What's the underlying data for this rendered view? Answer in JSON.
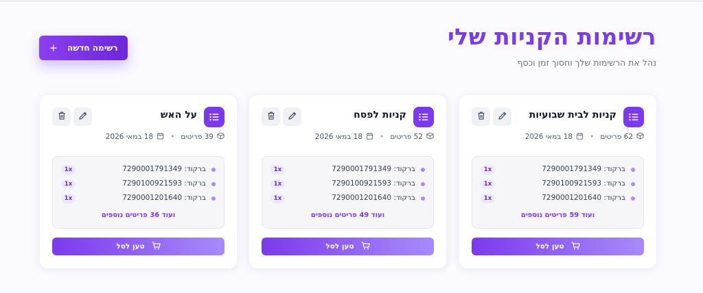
{
  "header": {
    "title": "רשימות הקניות שלי",
    "subtitle": "נהל את הרשימות שלך וחסוך זמן וכסף",
    "new_list_label": "רשימה חדשה"
  },
  "lists": [
    {
      "title": "קניות לבית שבועיות",
      "items_count": "62 פריטים",
      "date": "18 במאי 2026",
      "items": [
        {
          "barcode": "ברקוד: 7290001791349",
          "qty": "1x"
        },
        {
          "barcode": "ברקוד: 7290100921593",
          "qty": "1x"
        },
        {
          "barcode": "ברקוד: 7290001201640",
          "qty": "1x"
        }
      ],
      "more": "ועוד 59 פריטים נוספים",
      "load_label": "טען לסל"
    },
    {
      "title": "קניות לפסח",
      "items_count": "52 פריטים",
      "date": "18 במאי 2026",
      "items": [
        {
          "barcode": "ברקוד: 7290001791349",
          "qty": "1x"
        },
        {
          "barcode": "ברקוד: 7290100921593",
          "qty": "1x"
        },
        {
          "barcode": "ברקוד: 7290001201640",
          "qty": "1x"
        }
      ],
      "more": "ועוד 49 פריטים נוספים",
      "load_label": "טען לסל"
    },
    {
      "title": "על האש",
      "items_count": "39 פריטים",
      "date": "18 במאי 2026",
      "items": [
        {
          "barcode": "ברקוד: 7290001791349",
          "qty": "1x"
        },
        {
          "barcode": "ברקוד: 7290100921593",
          "qty": "1x"
        },
        {
          "barcode": "ברקוד: 7290001201640",
          "qty": "1x"
        }
      ],
      "more": "ועוד 36 פריטים נוספים",
      "load_label": "טען לסל"
    }
  ]
}
